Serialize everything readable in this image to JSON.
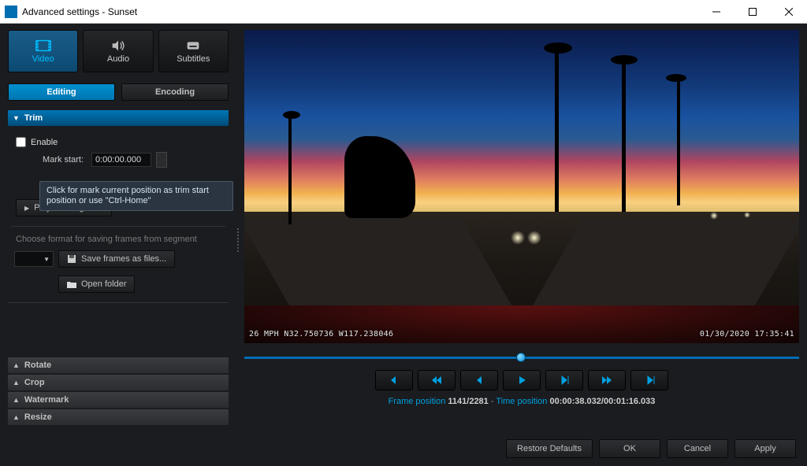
{
  "window": {
    "title": "Advanced settings - Sunset"
  },
  "tabs": {
    "video": "Video",
    "audio": "Audio",
    "subtitles": "Subtitles"
  },
  "subtabs": {
    "editing": "Editing",
    "encoding": "Encoding"
  },
  "trim": {
    "header": "Trim",
    "enable": "Enable",
    "mark_start": "Mark start:",
    "start_value": "0:00:00.000",
    "tooltip": "Click for mark current position as trim start position or use \"Ctrl-Home\"",
    "play_segment": "Play trim segment",
    "format_hint": "Choose format for saving frames from segment",
    "save_frames": "Save frames as files...",
    "open_folder": "Open folder"
  },
  "sections": {
    "rotate": "Rotate",
    "crop": "Crop",
    "watermark": "Watermark",
    "resize": "Resize"
  },
  "overlay": {
    "left": "26 MPH N32.750736 W117.238046",
    "right": "01/30/2020  17:35:41"
  },
  "position": {
    "frame_label": "Frame position",
    "frame_value": "1141/2281",
    "sep": " - ",
    "time_label": "Time position",
    "time_value": "00:00:38.032/00:01:16.033"
  },
  "footer": {
    "restore": "Restore Defaults",
    "ok": "OK",
    "cancel": "Cancel",
    "apply": "Apply"
  }
}
